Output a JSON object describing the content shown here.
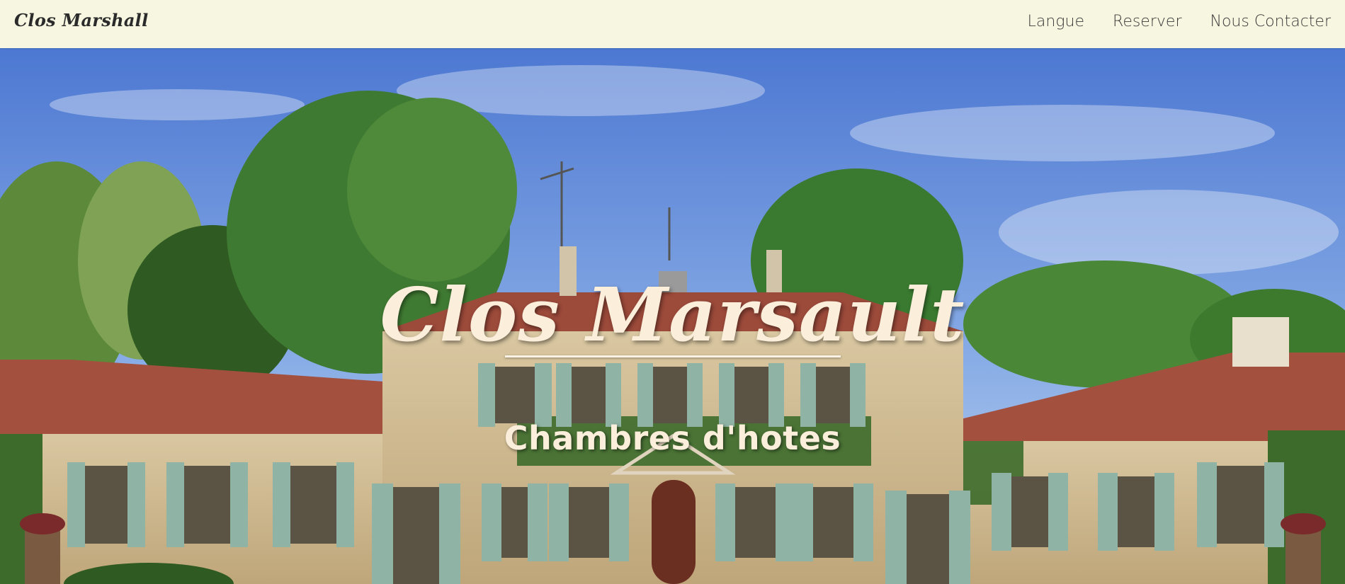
{
  "navbar": {
    "brand": "Clos Marshall",
    "links": [
      {
        "label": "Langue"
      },
      {
        "label": "Reserver"
      },
      {
        "label": "Nous Contacter"
      }
    ]
  },
  "hero": {
    "title": "Clos Marsault",
    "subtitle": "Chambres d'hotes",
    "image_description": "",
    "colors": {
      "text": "#fbefdc",
      "sky": "#5b86d8",
      "stone": "#cdb88f",
      "shutters": "#8fb3a4",
      "roof": "#a3503f",
      "foliage": "#3f7a32"
    }
  }
}
